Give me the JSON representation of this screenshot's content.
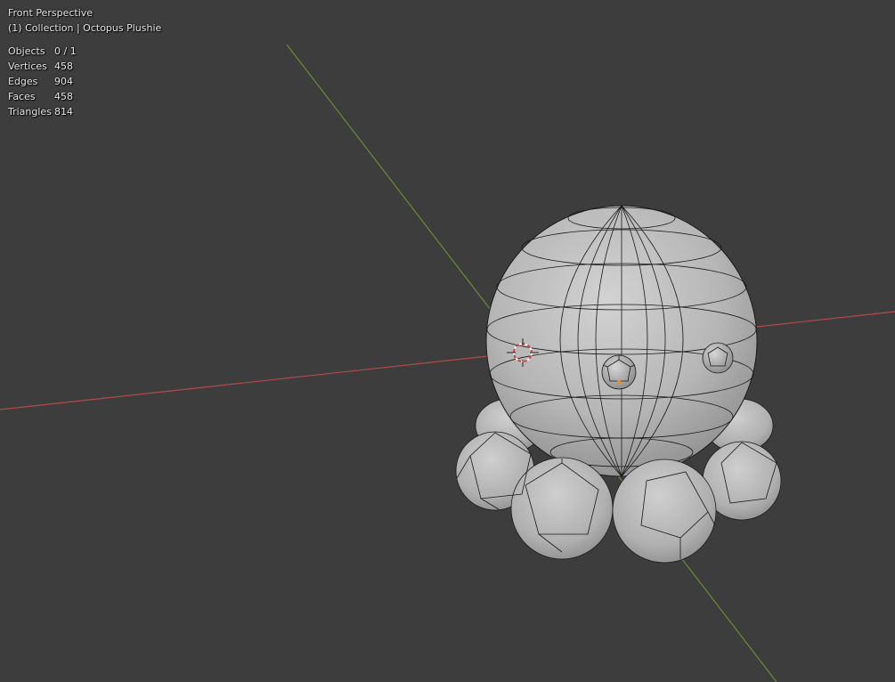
{
  "viewport": {
    "view_name": "Front Perspective",
    "collection_info": "(1) Collection | Octopus Plushie",
    "background_color": "#3d3d3d",
    "x_axis_color": "#b34a4a",
    "y_axis_color": "#6a8c2e",
    "mesh_color": "#bcbcbc",
    "wire_color": "#1a1a1a"
  },
  "stats": [
    {
      "label": "Objects",
      "value": "0 / 1"
    },
    {
      "label": "Vertices",
      "value": "458"
    },
    {
      "label": "Edges",
      "value": "904"
    },
    {
      "label": "Faces",
      "value": "458"
    },
    {
      "label": "Triangles",
      "value": "814"
    }
  ]
}
